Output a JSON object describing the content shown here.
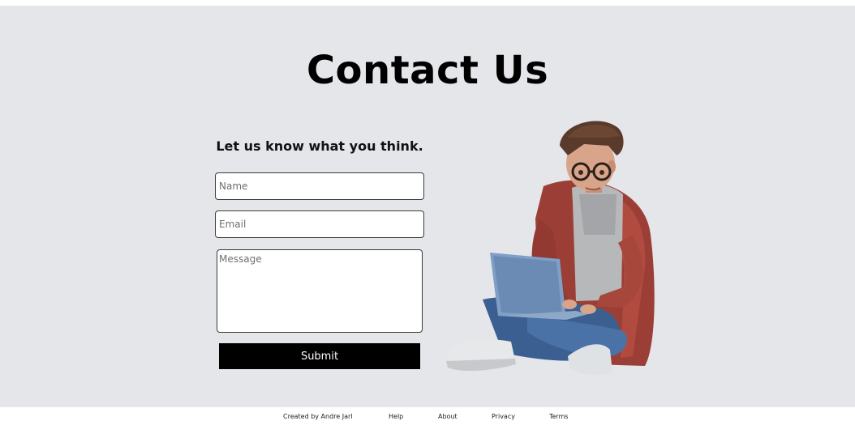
{
  "header": {
    "title": "Contact Us"
  },
  "form": {
    "subtitle": "Let us know what you think.",
    "name_placeholder": "Name",
    "email_placeholder": "Email",
    "message_placeholder": "Message",
    "submit_label": "Submit"
  },
  "illustration": {
    "icon": "student-with-laptop-illustration"
  },
  "footer": {
    "credit": "Created by Andre Jarl",
    "links": [
      "Help",
      "About",
      "Privacy",
      "Terms"
    ]
  },
  "colors": {
    "background": "#e5e6ea",
    "button": "#000000",
    "button_text": "#ffffff"
  }
}
